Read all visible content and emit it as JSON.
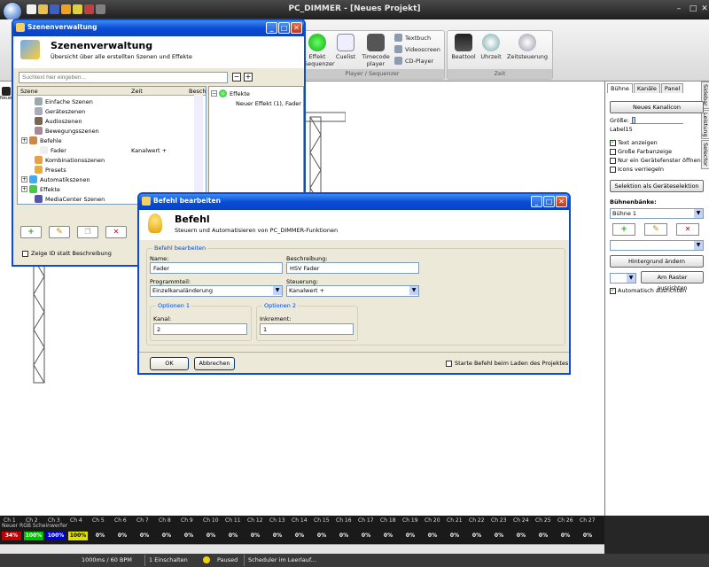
{
  "app": {
    "title": "PC_DIMMER - [Neues Projekt]",
    "colors": {
      "accent": "#0a4cd6",
      "ribbon": "#e3e3e3",
      "dark": "#262626"
    }
  },
  "ribbon": {
    "groups": [
      {
        "label": "Player / Sequenzer",
        "buttons": [
          "Effekt\nSequenzer",
          "Cuelist",
          "Timecode\nplayer"
        ],
        "small": [
          "Textbuch",
          "Videoscreen",
          "CD-Player"
        ]
      },
      {
        "label": "Zeit",
        "buttons": [
          "Beattool",
          "Uhrzeit",
          "Zeitsteuerung"
        ]
      }
    ]
  },
  "scene_window": {
    "title": "Szenenverwaltung",
    "heading": "Szenenverwaltung",
    "subheading": "Übersicht über alle erstellten Szenen und Effekte",
    "search_placeholder": "Suchtext hier eingeben...",
    "columns": [
      "Szene",
      "Zeit",
      "Beschr"
    ],
    "tree": [
      {
        "label": "Einfache Szenen",
        "time": "",
        "icon": "simple-scene-icon",
        "indent": 1
      },
      {
        "label": "Geräteszenen",
        "time": "",
        "icon": "device-scene-icon",
        "indent": 1
      },
      {
        "label": "Audioszenen",
        "time": "",
        "icon": "audio-scene-icon",
        "indent": 1
      },
      {
        "label": "Bewegungsszenen",
        "time": "",
        "icon": "motion-scene-icon",
        "indent": 1
      },
      {
        "label": "Befehle",
        "time": "",
        "icon": "command-icon",
        "indent": 0
      },
      {
        "label": "Fader",
        "time": "Kanalwert +",
        "icon": "fader-icon",
        "indent": 2
      },
      {
        "label": "Kombinationsszenen",
        "time": "",
        "icon": "combo-scene-icon",
        "indent": 1
      },
      {
        "label": "Presets",
        "time": "",
        "icon": "preset-icon",
        "indent": 1
      },
      {
        "label": "Automatikszenen",
        "time": "",
        "icon": "auto-scene-icon",
        "indent": 0
      },
      {
        "label": "Effekte",
        "time": "",
        "icon": "effect-icon",
        "indent": 0
      },
      {
        "label": "MediaCenter Szenen",
        "time": "",
        "icon": "mediacenter-icon",
        "indent": 1
      }
    ],
    "right_tree": {
      "root": "Effekte",
      "child": "Neuer Effekt (1), Fader"
    },
    "show_id_label": "Zeige ID statt Beschreibung"
  },
  "command_dialog": {
    "title": "Befehl bearbeiten",
    "heading": "Befehl",
    "subheading": "Steuern und Automatisieren von PC_DIMMER-Funktionen",
    "section": "Befehl bearbeiten",
    "name_label": "Name:",
    "name_value": "Fader",
    "desc_label": "Beschreibung:",
    "desc_value": "HSV Fader",
    "part_label": "Programmteil:",
    "part_value": "Einzelkanaländerung",
    "control_label": "Steuerung:",
    "control_value": "Kanalwert +",
    "opt1_title": "Optionen 1",
    "opt1_label": "Kanal:",
    "opt1_value": "2",
    "opt2_title": "Optionen 2",
    "opt2_label": "Inkrement:",
    "opt2_value": "1",
    "ok": "OK",
    "cancel": "Abbrechen",
    "startup_label": "Starte Befehl beim Laden des Projektes"
  },
  "sidebar": {
    "tabs": [
      "Bühne",
      "Kanäle",
      "Panel"
    ],
    "vtabs": [
      "Sidebar",
      "Leistung",
      "Selector"
    ],
    "new_channel": "Neues Kanalicon",
    "size_label": "Größe:",
    "label15": "Label15",
    "checks": [
      {
        "label": "Text anzeigen",
        "on": true
      },
      {
        "label": "Große Farbanzeige",
        "on": false
      },
      {
        "label": "Nur ein Gerätefenster öffnen",
        "on": false
      },
      {
        "label": "Icons verriegeln",
        "on": false
      }
    ],
    "selection_btn": "Selektion als Geräteselektion",
    "stages_label": "Bühnenbänke:",
    "stage_value": "Bühne 1",
    "bg_btn": "Hintergrund ändern",
    "grid_btn": "Am Raster ausrichten",
    "auto_align": "Automatisch ausrichten"
  },
  "channels": {
    "fixture": "Neuer RGB Scheinwerfer",
    "labels": [
      "Ch 1",
      "Ch 2",
      "Ch 3",
      "Ch 4",
      "Ch 5",
      "Ch 6",
      "Ch 7",
      "Ch 8",
      "Ch 9",
      "Ch 10",
      "Ch 11",
      "Ch 12",
      "Ch 13",
      "Ch 14",
      "Ch 15",
      "Ch 16",
      "Ch 17",
      "Ch 18",
      "Ch 19",
      "Ch 20",
      "Ch 21",
      "Ch 22",
      "Ch 23",
      "Ch 24",
      "Ch 25",
      "Ch 26",
      "Ch 27"
    ],
    "values": [
      "34%",
      "100%",
      "100%",
      "100%",
      "0%",
      "0%",
      "0%",
      "0%",
      "0%",
      "0%",
      "0%",
      "0%",
      "0%",
      "0%",
      "0%",
      "0%",
      "0%",
      "0%",
      "0%",
      "0%",
      "0%",
      "0%",
      "0%",
      "0%",
      "0%",
      "0%",
      "0%"
    ],
    "value_colors": [
      "#c00000",
      "#00c000",
      "#0000d0",
      "#e0e000"
    ]
  },
  "status": {
    "bpm": "1000ms / 60 BPM",
    "switch": "1 Einschalten",
    "paused": "Paused",
    "scheduler": "Scheduler im Leerlauf..."
  }
}
